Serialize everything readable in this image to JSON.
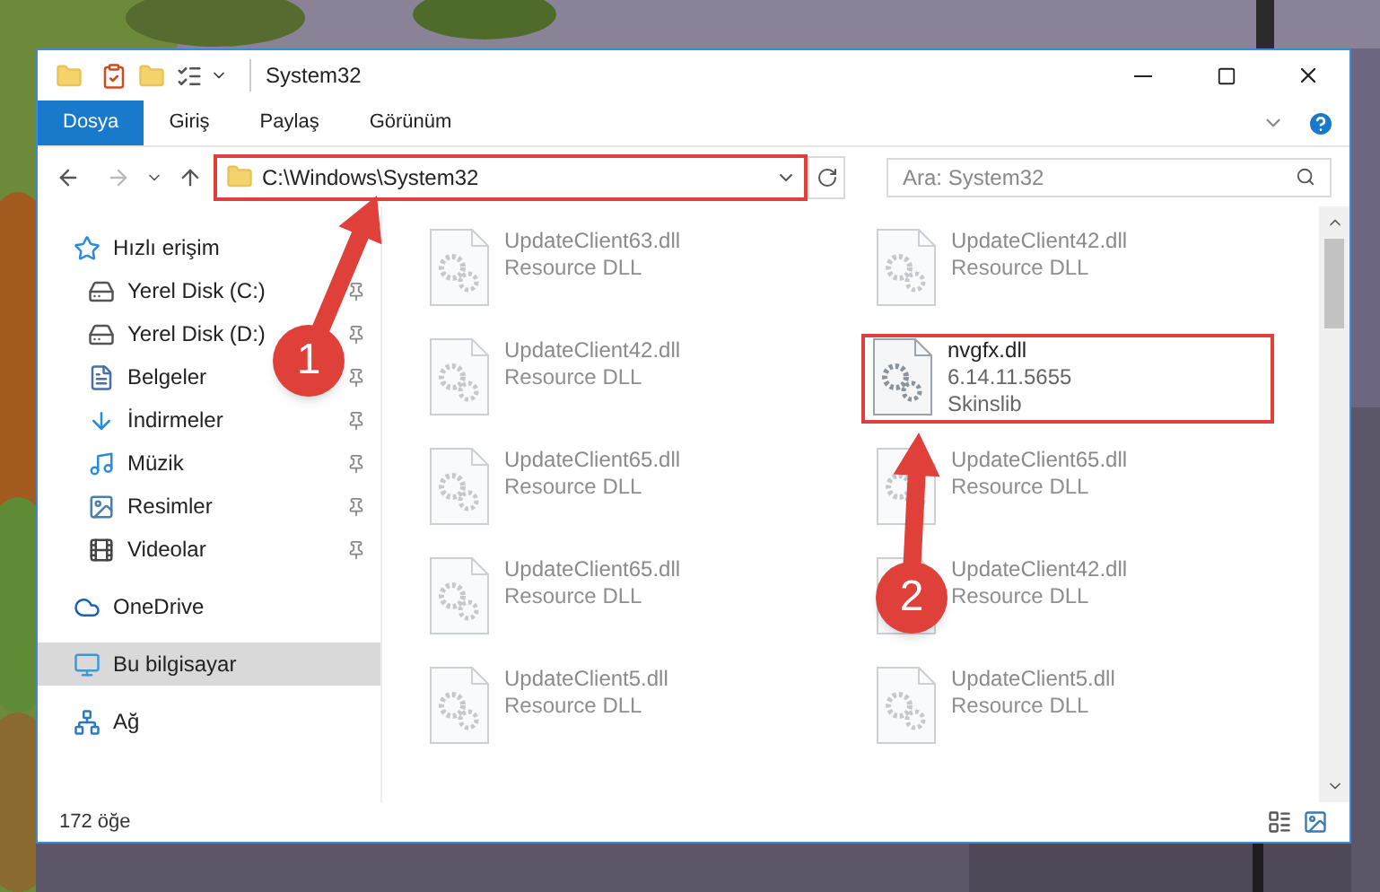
{
  "window": {
    "title": "System32"
  },
  "ribbon_tabs": [
    {
      "label": "Dosya",
      "selected": true
    },
    {
      "label": "Giriş",
      "selected": false
    },
    {
      "label": "Paylaş",
      "selected": false
    },
    {
      "label": "Görünüm",
      "selected": false
    }
  ],
  "address": {
    "value": "C:\\Windows\\System32",
    "highlighted": true
  },
  "search": {
    "placeholder": "Ara: System32"
  },
  "sidebar": {
    "items": [
      {
        "label": "Hızlı erişim",
        "kind": "quickaccess",
        "selected": false,
        "children": [
          {
            "label": "Yerel Disk (C:)",
            "kind": "systemdrive",
            "pinned": true,
            "selected": false
          },
          {
            "label": "Yerel Disk (D:)",
            "kind": "drive",
            "pinned": true,
            "selected": false
          },
          {
            "label": "Belgeler",
            "kind": "documents",
            "pinned": true,
            "selected": false
          },
          {
            "label": "İndirmeler",
            "kind": "downloads",
            "pinned": true,
            "selected": false
          },
          {
            "label": "Müzik",
            "kind": "music",
            "pinned": true,
            "selected": false
          },
          {
            "label": "Resimler",
            "kind": "pictures",
            "pinned": true,
            "selected": false
          },
          {
            "label": "Videolar",
            "kind": "videos",
            "pinned": true,
            "selected": false
          }
        ]
      },
      {
        "label": "OneDrive",
        "kind": "cloud",
        "selected": false
      },
      {
        "label": "Bu bilgisayar",
        "kind": "computer",
        "selected": true
      },
      {
        "label": "Ağ",
        "kind": "network",
        "selected": false
      }
    ]
  },
  "files": [
    {
      "name": "UpdateClient63.dll",
      "detail": "Resource DLL",
      "blurred": true,
      "highlighted": false
    },
    {
      "name": "UpdateClient42.dll",
      "detail": "Resource DLL",
      "blurred": true,
      "highlighted": false
    },
    {
      "name": "UpdateClient42.dll",
      "detail": "Resource DLL",
      "blurred": true,
      "highlighted": false
    },
    {
      "name": "nvgfx.dll",
      "detail": "6.14.11.5655",
      "detail2": "Skinslib",
      "blurred": false,
      "highlighted": true
    },
    {
      "name": "UpdateClient65.dll",
      "detail": "Resource DLL",
      "blurred": true,
      "highlighted": false
    },
    {
      "name": "UpdateClient65.dll",
      "detail": "Resource DLL",
      "blurred": true,
      "highlighted": false
    },
    {
      "name": "UpdateClient65.dll",
      "detail": "Resource DLL",
      "blurred": true,
      "highlighted": false
    },
    {
      "name": "UpdateClient42.dll",
      "detail": "Resource DLL",
      "blurred": true,
      "highlighted": false
    },
    {
      "name": "UpdateClient5.dll",
      "detail": "Resource DLL",
      "blurred": true,
      "highlighted": false
    },
    {
      "name": "UpdateClient5.dll",
      "detail": "Resource DLL",
      "blurred": true,
      "highlighted": false
    }
  ],
  "callouts": [
    {
      "number": "1"
    },
    {
      "number": "2"
    }
  ],
  "status_bar": {
    "count": "172 öğe"
  }
}
